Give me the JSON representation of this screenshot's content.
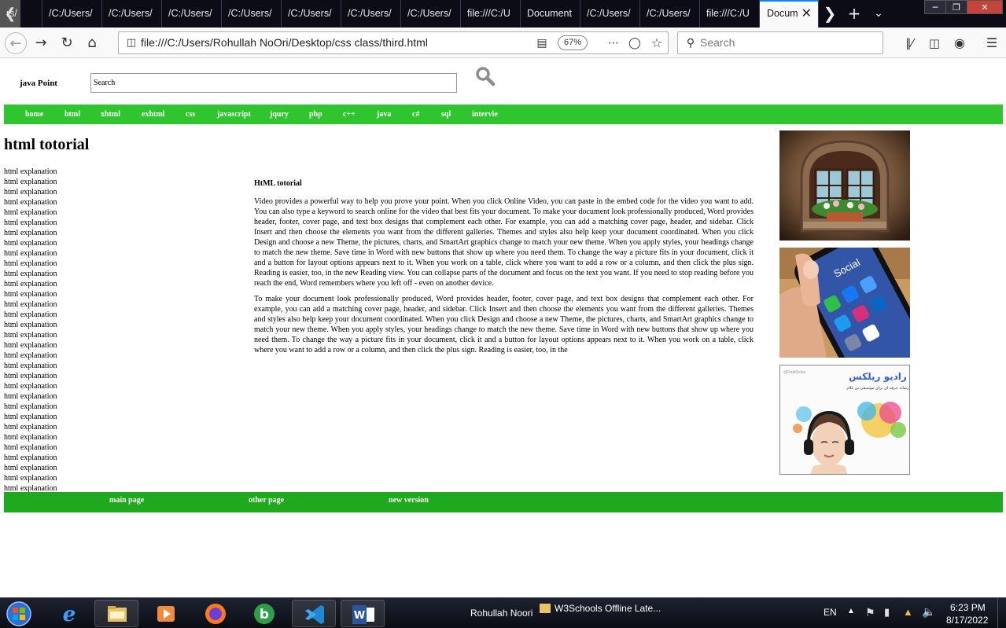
{
  "browser": {
    "tabs": [
      {
        "label": "rs/"
      },
      {
        "label": "/C:/Users/"
      },
      {
        "label": "/C:/Users/"
      },
      {
        "label": "/C:/Users/"
      },
      {
        "label": "/C:/Users/"
      },
      {
        "label": "/C:/Users/"
      },
      {
        "label": "/C:/Users/"
      },
      {
        "label": "/C:/Users/"
      },
      {
        "label": "file:///C:/U"
      },
      {
        "label": "Document"
      },
      {
        "label": "/C:/Users/"
      },
      {
        "label": "/C:/Users/"
      },
      {
        "label": "file:///C:/U"
      },
      {
        "label": "Docum"
      }
    ],
    "url": "file:///C:/Users/Rohullah NoOri/Desktop/css class/third.html",
    "zoom": "67%",
    "search_placeholder": "Search"
  },
  "site": {
    "brand": "java Point",
    "search_value": "Search",
    "menu": [
      "home",
      "html",
      "xhtml",
      "exhtml",
      "css",
      "javascript",
      "jqury",
      "php",
      "c++",
      "java",
      "c#",
      "sql",
      "intervie"
    ],
    "title": "html totorial",
    "sidebar_items": [
      "html explanation",
      "html explanation",
      "html explanation",
      "html explanation",
      "html explanation",
      "html explanation",
      "html explanation",
      "html explanation",
      "html explanation",
      "html explanation",
      "html explanation",
      "html explanation",
      "html explanation",
      "html explanation",
      "html explanation",
      "html explanation",
      "html explanation",
      "html explanation",
      "html explanation",
      "html explanation",
      "html explanation",
      "html explanation",
      "html explanation",
      "html explanation",
      "html explanation",
      "html explanation",
      "html explanation",
      "html explanation",
      "html explanation",
      "html explanation",
      "html explanation",
      "html explanation"
    ],
    "article": {
      "heading": "HtML totorial",
      "paragraphs": [
        "Video provides a powerful way to help you prove your point. When you click Online Video, you can paste in the embed code for the video you want to add. You can also type a keyword to search online for the video that best fits your document. To make your document look professionally produced, Word provides header, footer, cover page, and text box designs that complement each other. For example, you can add a matching cover page, header, and sidebar. Click Insert and then choose the elements you want from the different galleries. Themes and styles also help keep your document coordinated. When you click Design and choose a new Theme, the pictures, charts, and SmartArt graphics change to match your new theme. When you apply styles, your headings change to match the new theme. Save time in Word with new buttons that show up where you need them. To change the way a picture fits in your document, click it and a button for layout options appears next to it. When you work on a table, click where you want to add a row or a column, and then click the plus sign. Reading is easier, too, in the new Reading view. You can collapse parts of the document and focus on the text you want. If you need to stop reading before you reach the end, Word remembers where you left off - even on another device.",
        "To make your document look professionally produced, Word provides header, footer, cover page, and text box designs that complement each other. For example, you can add a matching cover page, header, and sidebar. Click Insert and then choose the elements you want from the different galleries. Themes and styles also help keep your document coordinated. When you click Design and choose a new Theme, the pictures, charts, and SmartArt graphics change to match your new theme. When you apply styles, your headings change to match the new theme. Save time in Word with new buttons that show up where you need them. To change the way a picture fits in your document, click it and a button for layout options appears next to it. When you work on a table, click where you want to add a row or a column, and then click the plus sign. Reading is easier, too, in the"
      ]
    },
    "images": {
      "radio_logo_text": "رادیو ریلکس",
      "radio_tagline": "رسانه حرفه ای برای موسیقی بی کلام",
      "radio_handle": "@RadiRelax",
      "phone_screen_text": "Social"
    },
    "footer": [
      "main page",
      "other page",
      "new version"
    ]
  },
  "taskbar": {
    "user": "Rohullah Noori",
    "window_title": "W3Schools Offline Late...",
    "language": "EN",
    "time": "6:23 PM",
    "date": "8/17/2022"
  },
  "colors": {
    "menu_bg": "#2ec52e",
    "footer_bg": "#1fa91f",
    "tabbar_bg": "#0c0c17",
    "active_tab_accent": "#0a84ff"
  }
}
